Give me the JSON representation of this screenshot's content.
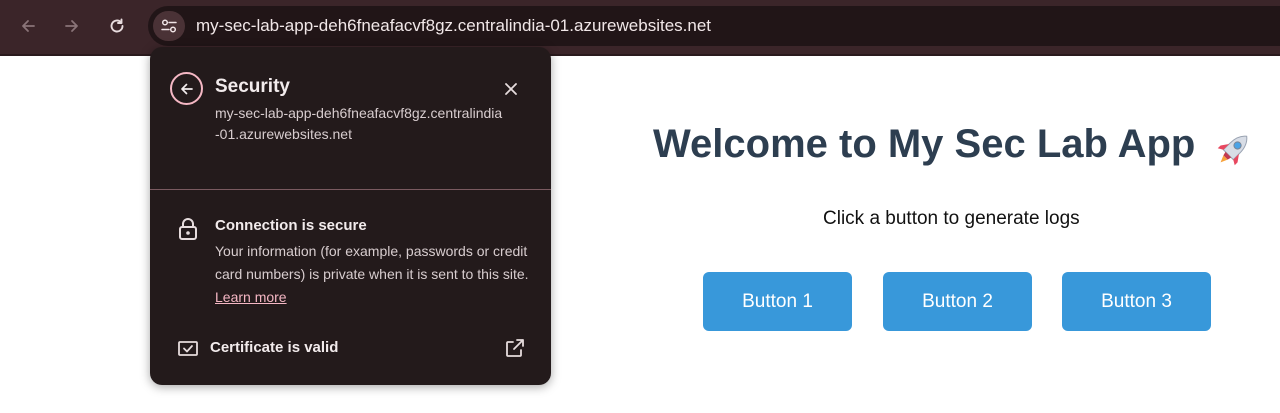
{
  "browser": {
    "url": "my-sec-lab-app-deh6fneafacvf8gz.centralindia-01.azurewebsites.net",
    "icons": {
      "back": "back-arrow-icon",
      "forward": "forward-arrow-icon",
      "reload": "reload-icon",
      "site_info": "site-settings-icon"
    },
    "colors": {
      "toolbar": "#3b2529",
      "omnibox": "#211517"
    }
  },
  "page": {
    "title": "Welcome to My Sec Lab App",
    "title_emoji_icon": "rocket-icon",
    "subtitle": "Click a button to generate logs",
    "buttons": [
      "Button 1",
      "Button 2",
      "Button 3"
    ],
    "colors": {
      "title": "#2d3e50",
      "button": "#3898da"
    }
  },
  "security_popup": {
    "title": "Security",
    "host": "my-sec-lab-app-deh6fneafacvf8gz.centralindia-01.azurewebsites.net",
    "connection_title": "Connection is secure",
    "connection_desc": "Your information (for example, passwords or credit card numbers) is private when it is sent to this site.",
    "learn_more": "Learn more",
    "certificate_label": "Certificate is valid",
    "colors": {
      "background": "#231a1b",
      "accent": "#f5b7c4"
    }
  }
}
